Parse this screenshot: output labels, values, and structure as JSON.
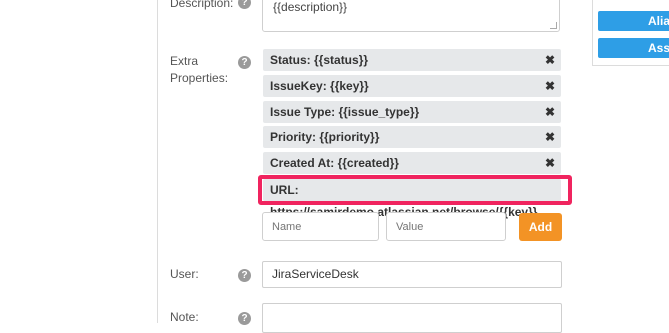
{
  "side_buttons": [
    {
      "label": "Alia"
    },
    {
      "label": "Assign"
    }
  ],
  "description": {
    "label": "Description:",
    "value": "{{description}}"
  },
  "extra_properties": {
    "label_line1": "Extra",
    "label_line2": "Properties:",
    "items": [
      {
        "text": "Status: {{status}}"
      },
      {
        "text": "IssueKey: {{key}}"
      },
      {
        "text": "Issue Type: {{issue_type}}"
      },
      {
        "text": "Priority: {{priority}}"
      },
      {
        "text": "Created At: {{created}}"
      },
      {
        "text": "URL: https://samirdemo.atlassian.net/browse/{{key}}"
      }
    ],
    "name_placeholder": "Name",
    "value_placeholder": "Value",
    "add_label": "Add",
    "remove_glyph": "✖",
    "highlight_color": "#f0245f"
  },
  "user": {
    "label": "User:",
    "value": "JiraServiceDesk"
  },
  "note": {
    "label": "Note:"
  },
  "help_glyph": "?",
  "colors": {
    "accent_blue": "#2e9ee6",
    "add_orange": "#f39325",
    "chip_bg": "#e6e8ea"
  }
}
